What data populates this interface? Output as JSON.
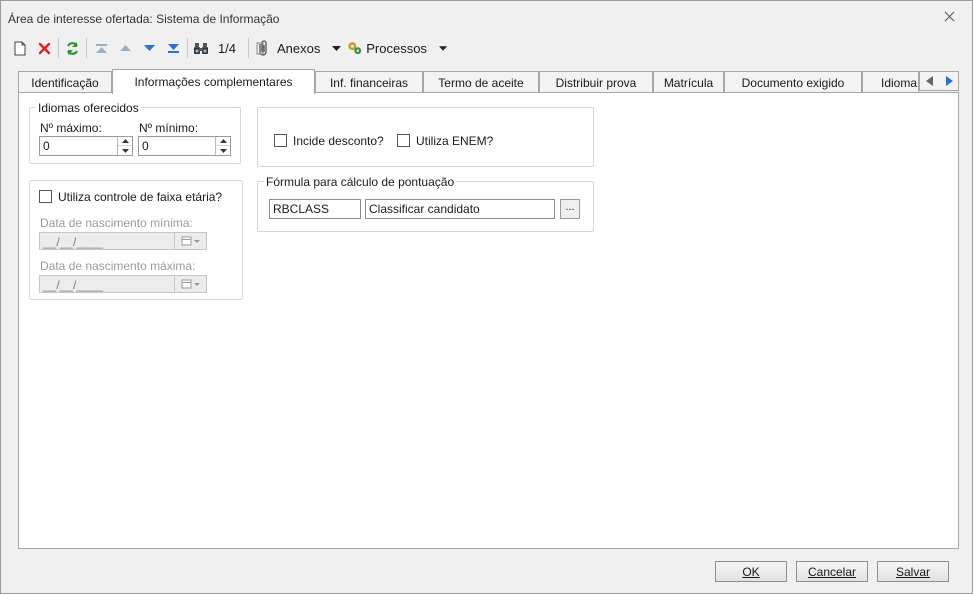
{
  "window": {
    "title": "Área de interesse ofertada: Sistema de Informação"
  },
  "toolbar": {
    "record_counter": "1/4",
    "anexos_label": "Anexos",
    "processos_label": "Processos"
  },
  "tabs": [
    {
      "label": "Identificação",
      "active": false
    },
    {
      "label": "Informações complementares",
      "active": true
    },
    {
      "label": "Inf. financeiras",
      "active": false
    },
    {
      "label": "Termo de aceite",
      "active": false
    },
    {
      "label": "Distribuir prova",
      "active": false
    },
    {
      "label": "Matrícula",
      "active": false
    },
    {
      "label": "Documento exigido",
      "active": false
    },
    {
      "label": "Idioma o",
      "active": false
    }
  ],
  "idiomas": {
    "legend": "Idiomas oferecidos",
    "max_label": "Nº máximo:",
    "max_value": "0",
    "min_label": "Nº mínimo:",
    "min_value": "0"
  },
  "faixa_etaria": {
    "checkbox_label": "Utiliza controle de faixa etária?",
    "checked": false,
    "data_min_label": "Data de nascimento mínima:",
    "data_min_value": "__/__/____",
    "data_max_label": "Data de nascimento máxima:",
    "data_max_value": "__/__/____"
  },
  "opcoes": {
    "incide_desconto_label": "Incide desconto?",
    "incide_desconto_checked": false,
    "utiliza_enem_label": "Utiliza ENEM?",
    "utiliza_enem_checked": false
  },
  "formula": {
    "legend": "Fórmula para cálculo de pontuação",
    "code": "RBCLASS",
    "description": "Classificar candidato",
    "lookup_label": "..."
  },
  "buttons": {
    "ok_label": "OK",
    "cancel_label": "Cancelar",
    "save_label": "Salvar"
  },
  "colors": {
    "delete_red": "#e02020",
    "refresh_green": "#2a9a2a",
    "nav_blue": "#2a6fd6"
  }
}
